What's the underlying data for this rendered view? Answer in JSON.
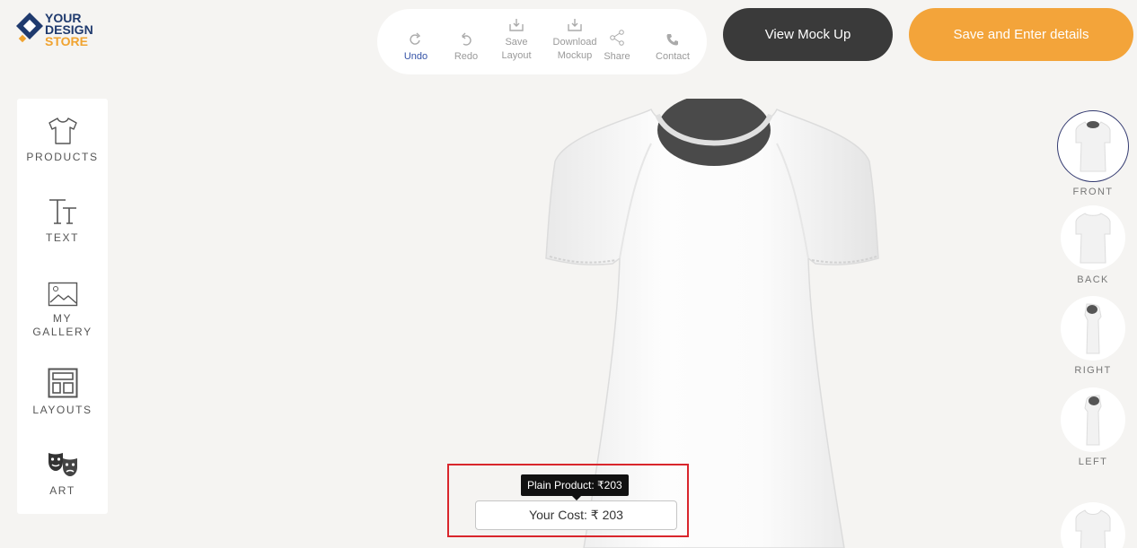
{
  "brand": {
    "line1": "YOUR",
    "line2": "DESIGN",
    "line3": "STORE",
    "color_primary": "#1f3a6e",
    "color_accent": "#f0a330"
  },
  "toolbar": {
    "items": [
      {
        "label": "Undo",
        "icon": "undo-icon",
        "active": true
      },
      {
        "label": "Redo",
        "icon": "redo-icon"
      },
      {
        "label_line1": "Save",
        "label_line2": "Layout",
        "icon": "save-layout-icon"
      },
      {
        "label_line1": "Download",
        "label_line2": "Mockup",
        "icon": "download-icon"
      },
      {
        "label": "Share",
        "icon": "share-icon"
      },
      {
        "label": "Contact",
        "icon": "phone-icon"
      }
    ]
  },
  "actions": {
    "view_mockup": "View Mock Up",
    "save_details": "Save and Enter details",
    "dark_color": "#3a3a3a",
    "orange_color": "#f3a43a"
  },
  "sidebar": {
    "items": [
      {
        "label": "PRODUCTS",
        "icon": "tshirt-icon"
      },
      {
        "label": "TEXT",
        "icon": "text-icon"
      },
      {
        "label_line1": "MY",
        "label_line2": "GALLERY",
        "icon": "gallery-icon"
      },
      {
        "label": "LAYOUTS",
        "icon": "layouts-icon"
      },
      {
        "label": "ART",
        "icon": "theater-masks-icon"
      }
    ]
  },
  "views": [
    {
      "label": "FRONT",
      "active": true
    },
    {
      "label": "BACK"
    },
    {
      "label": "RIGHT"
    },
    {
      "label": "LEFT"
    }
  ],
  "pricing": {
    "tooltip": "Plain Product: ₹203",
    "cost": "Your Cost: ₹ 203",
    "highlight_color": "#d9262c"
  }
}
